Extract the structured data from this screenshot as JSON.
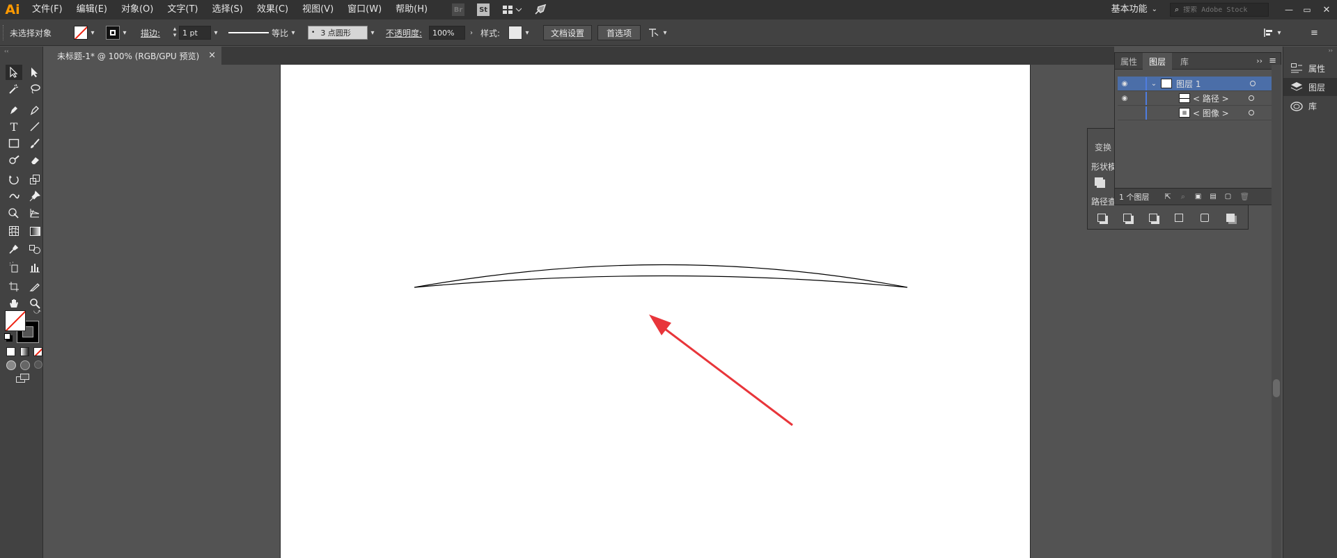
{
  "app": {
    "logo": "Ai"
  },
  "menu": [
    "文件(F)",
    "编辑(E)",
    "对象(O)",
    "文字(T)",
    "选择(S)",
    "效果(C)",
    "视图(V)",
    "窗口(W)",
    "帮助(H)"
  ],
  "menu_icons": {
    "bridge": "Br",
    "stock": "St"
  },
  "workspace": {
    "label": "基本功能",
    "search_placeholder": "搜索 Adobe Stock"
  },
  "window_controls": {
    "minimize": "—",
    "restore": "▭",
    "close": "✕"
  },
  "controlbar": {
    "selection_label": "未选择对象",
    "stroke_label": "描边:",
    "stroke_weight": "1 pt",
    "profile_label": "等比",
    "brush_label": "3 点圆形",
    "opacity_label": "不透明度:",
    "opacity_value": "100%",
    "style_label": "样式:",
    "doc_setup_button": "文档设置",
    "preferences_button": "首选项"
  },
  "document": {
    "tab_title": "未标题-1* @ 100% (RGB/GPU 预览)",
    "close": "×"
  },
  "layers_panel": {
    "tabs": [
      "属性",
      "图层",
      "库"
    ],
    "active_tab": "图层",
    "layers": [
      {
        "name": "图层 1",
        "visible": true,
        "expanded": true,
        "selected": true
      },
      {
        "name": "< 路径 >",
        "visible": true,
        "child": true
      },
      {
        "name": "< 图像 >",
        "visible": false,
        "child": true
      }
    ],
    "footer_count": "1 个图层"
  },
  "transform_panel": {
    "title": "变换",
    "shape_modes_label": "形状模",
    "pathfinder_label": "路径查"
  },
  "right_dock": [
    {
      "label": "属性",
      "icon": "properties-icon"
    },
    {
      "label": "图层",
      "icon": "layers-icon"
    },
    {
      "label": "库",
      "icon": "libraries-icon"
    }
  ],
  "colors": {
    "menubar": "#323232",
    "panel": "#535353",
    "accent_selected": "#4b6ea8",
    "arrow": "#e8353a",
    "logo": "#ff9a00"
  }
}
